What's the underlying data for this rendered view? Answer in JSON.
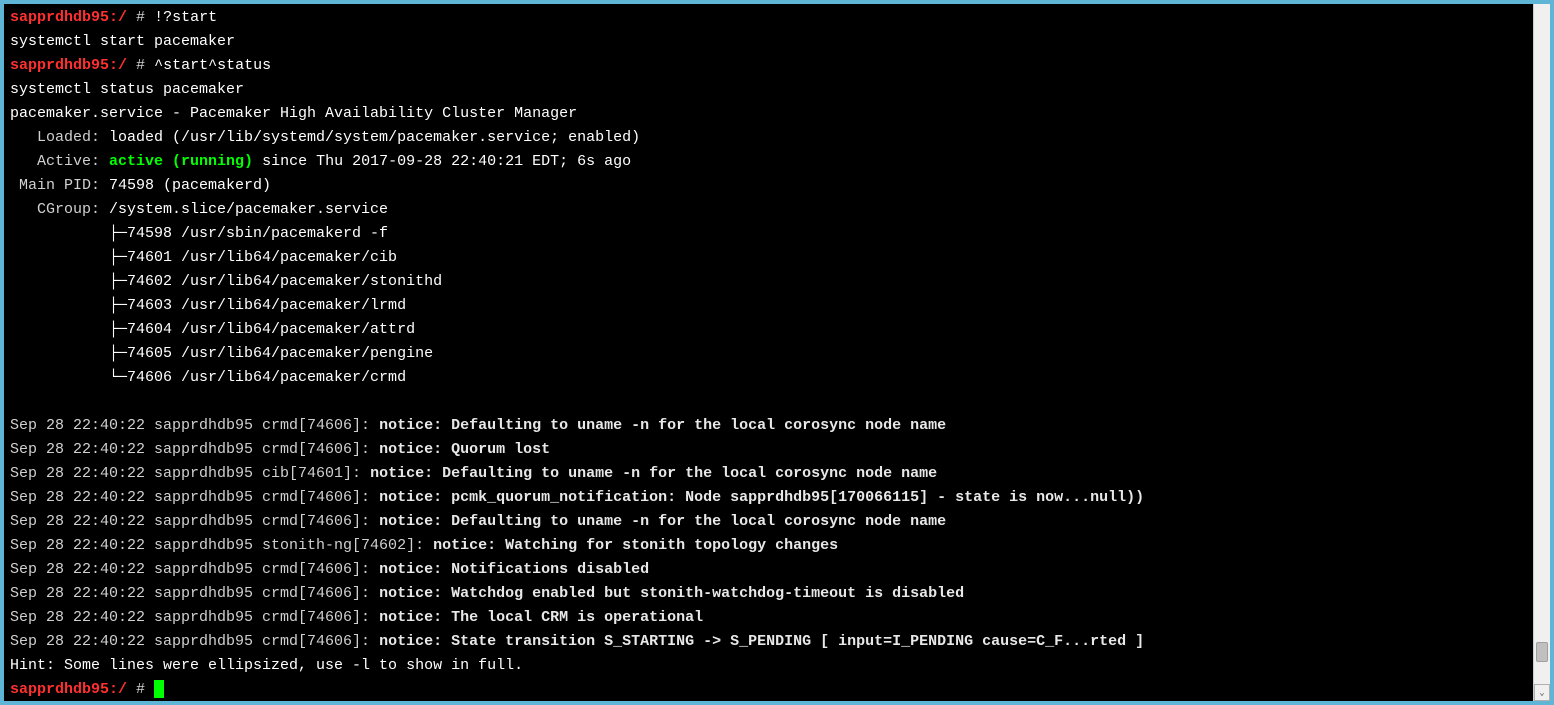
{
  "prompt": {
    "host": "sapprdhdb95:/",
    "symbol": "#"
  },
  "commands": {
    "c1": "!?start",
    "c2": "systemctl start pacemaker",
    "c3": "^start^status",
    "c4": "systemctl status pacemaker"
  },
  "status": {
    "unit_line": "pacemaker.service - Pacemaker High Availability Cluster Manager",
    "loaded_label": "   Loaded:",
    "loaded_value": " loaded (/usr/lib/systemd/system/pacemaker.service; enabled)",
    "active_label": "   Active: ",
    "active_state": "active (running)",
    "active_rest": " since Thu 2017-09-28 22:40:21 EDT; 6s ago",
    "mainpid_label": " Main PID:",
    "mainpid_value": " 74598 (pacemakerd)",
    "cgroup_label": "   CGroup:",
    "cgroup_value": " /system.slice/pacemaker.service",
    "proc1": "           ├─74598 /usr/sbin/pacemakerd -f",
    "proc2": "           ├─74601 /usr/lib64/pacemaker/cib",
    "proc3": "           ├─74602 /usr/lib64/pacemaker/stonithd",
    "proc4": "           ├─74603 /usr/lib64/pacemaker/lrmd",
    "proc5": "           ├─74604 /usr/lib64/pacemaker/attrd",
    "proc6": "           ├─74605 /usr/lib64/pacemaker/pengine",
    "proc7": "           └─74606 /usr/lib64/pacemaker/crmd"
  },
  "logs": [
    {
      "pre": "Sep 28 22:40:22 sapprdhdb95 crmd[74606]: ",
      "bold": "notice: Defaulting to uname -n for the local corosync node name"
    },
    {
      "pre": "Sep 28 22:40:22 sapprdhdb95 crmd[74606]: ",
      "bold": "notice: Quorum lost"
    },
    {
      "pre": "Sep 28 22:40:22 sapprdhdb95 cib[74601]: ",
      "bold": "notice: Defaulting to uname -n for the local corosync node name"
    },
    {
      "pre": "Sep 28 22:40:22 sapprdhdb95 crmd[74606]: ",
      "bold": "notice: pcmk_quorum_notification: Node sapprdhdb95[170066115] - state is now...null))"
    },
    {
      "pre": "Sep 28 22:40:22 sapprdhdb95 crmd[74606]: ",
      "bold": "notice: Defaulting to uname -n for the local corosync node name"
    },
    {
      "pre": "Sep 28 22:40:22 sapprdhdb95 stonith-ng[74602]: ",
      "bold": "notice: Watching for stonith topology changes"
    },
    {
      "pre": "Sep 28 22:40:22 sapprdhdb95 crmd[74606]: ",
      "bold": "notice: Notifications disabled"
    },
    {
      "pre": "Sep 28 22:40:22 sapprdhdb95 crmd[74606]: ",
      "bold": "notice: Watchdog enabled but stonith-watchdog-timeout is disabled"
    },
    {
      "pre": "Sep 28 22:40:22 sapprdhdb95 crmd[74606]: ",
      "bold": "notice: The local CRM is operational"
    },
    {
      "pre": "Sep 28 22:40:22 sapprdhdb95 crmd[74606]: ",
      "bold": "notice: State transition S_STARTING -> S_PENDING [ input=I_PENDING cause=C_F...rted ]"
    }
  ],
  "hint": "Hint: Some lines were ellipsized, use -l to show in full.",
  "scroll": {
    "down": "⌄"
  }
}
